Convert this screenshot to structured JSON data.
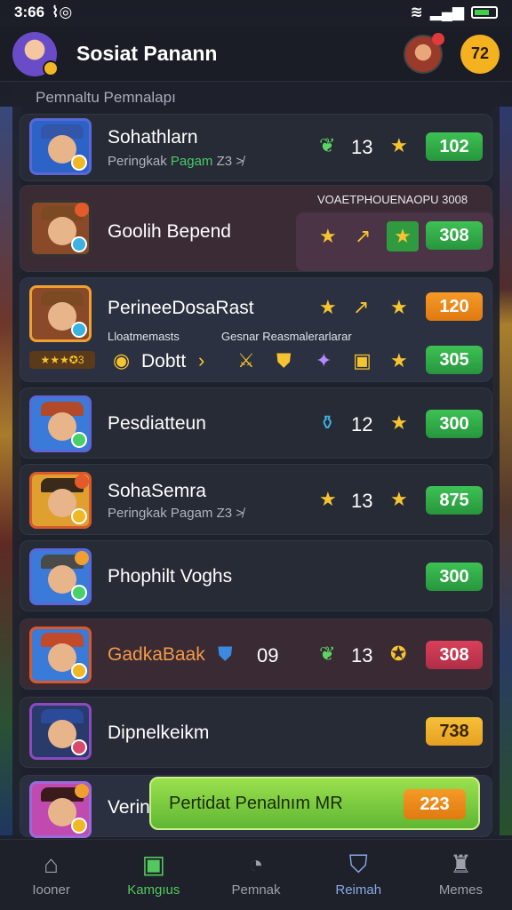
{
  "status": {
    "time": "3:66"
  },
  "header": {
    "title": "Sosiat Panann",
    "coin_value": "72"
  },
  "list": {
    "section_title": "Pemnaltu Pemnalapı",
    "rows": [
      {
        "name": "Sohathlarn",
        "sub_prefix": "Peringkak",
        "sub_green": "Pagam",
        "sub_suffix": "Z3 ≯",
        "count": "13",
        "value": "102"
      },
      {
        "name": "Goolih Bepend",
        "top_caption": "VOAETPHOUENAOPU 3008",
        "value": "308"
      },
      {
        "name": "PerineeDosaRast",
        "value": "120",
        "caption_left": "Lloatmemasts",
        "caption_right": "Gesnar Reasmalerarlarar",
        "score": "3",
        "sub_label": "Dobtt",
        "value2": "305"
      },
      {
        "name": "Pesdiatteun",
        "count": "12",
        "value": "300"
      },
      {
        "name": "SohaSemra",
        "sub_prefix": "Peringkak",
        "sub_green": "",
        "sub_suffix": "Pagam Z3 ≯",
        "count": "13",
        "value": "875"
      },
      {
        "name": "Phophilt Voghs",
        "value": "300"
      },
      {
        "name": "GadkaBaak",
        "count1": "09",
        "count2": "13",
        "value": "308"
      },
      {
        "name": "Dipnelkeikm",
        "value": "738"
      },
      {
        "name": "Verino",
        "value": ""
      }
    ]
  },
  "promo": {
    "label": "Pertidat Penalnım MR",
    "value": "223"
  },
  "tabs": [
    {
      "label": "Iooner",
      "icon": "home-icon"
    },
    {
      "label": "Kamgıus",
      "icon": "robot-icon"
    },
    {
      "label": "Pemnak",
      "icon": "timer-icon"
    },
    {
      "label": "Reimah",
      "icon": "shield-heart-icon"
    },
    {
      "label": "Memes",
      "icon": "people-icon"
    }
  ]
}
